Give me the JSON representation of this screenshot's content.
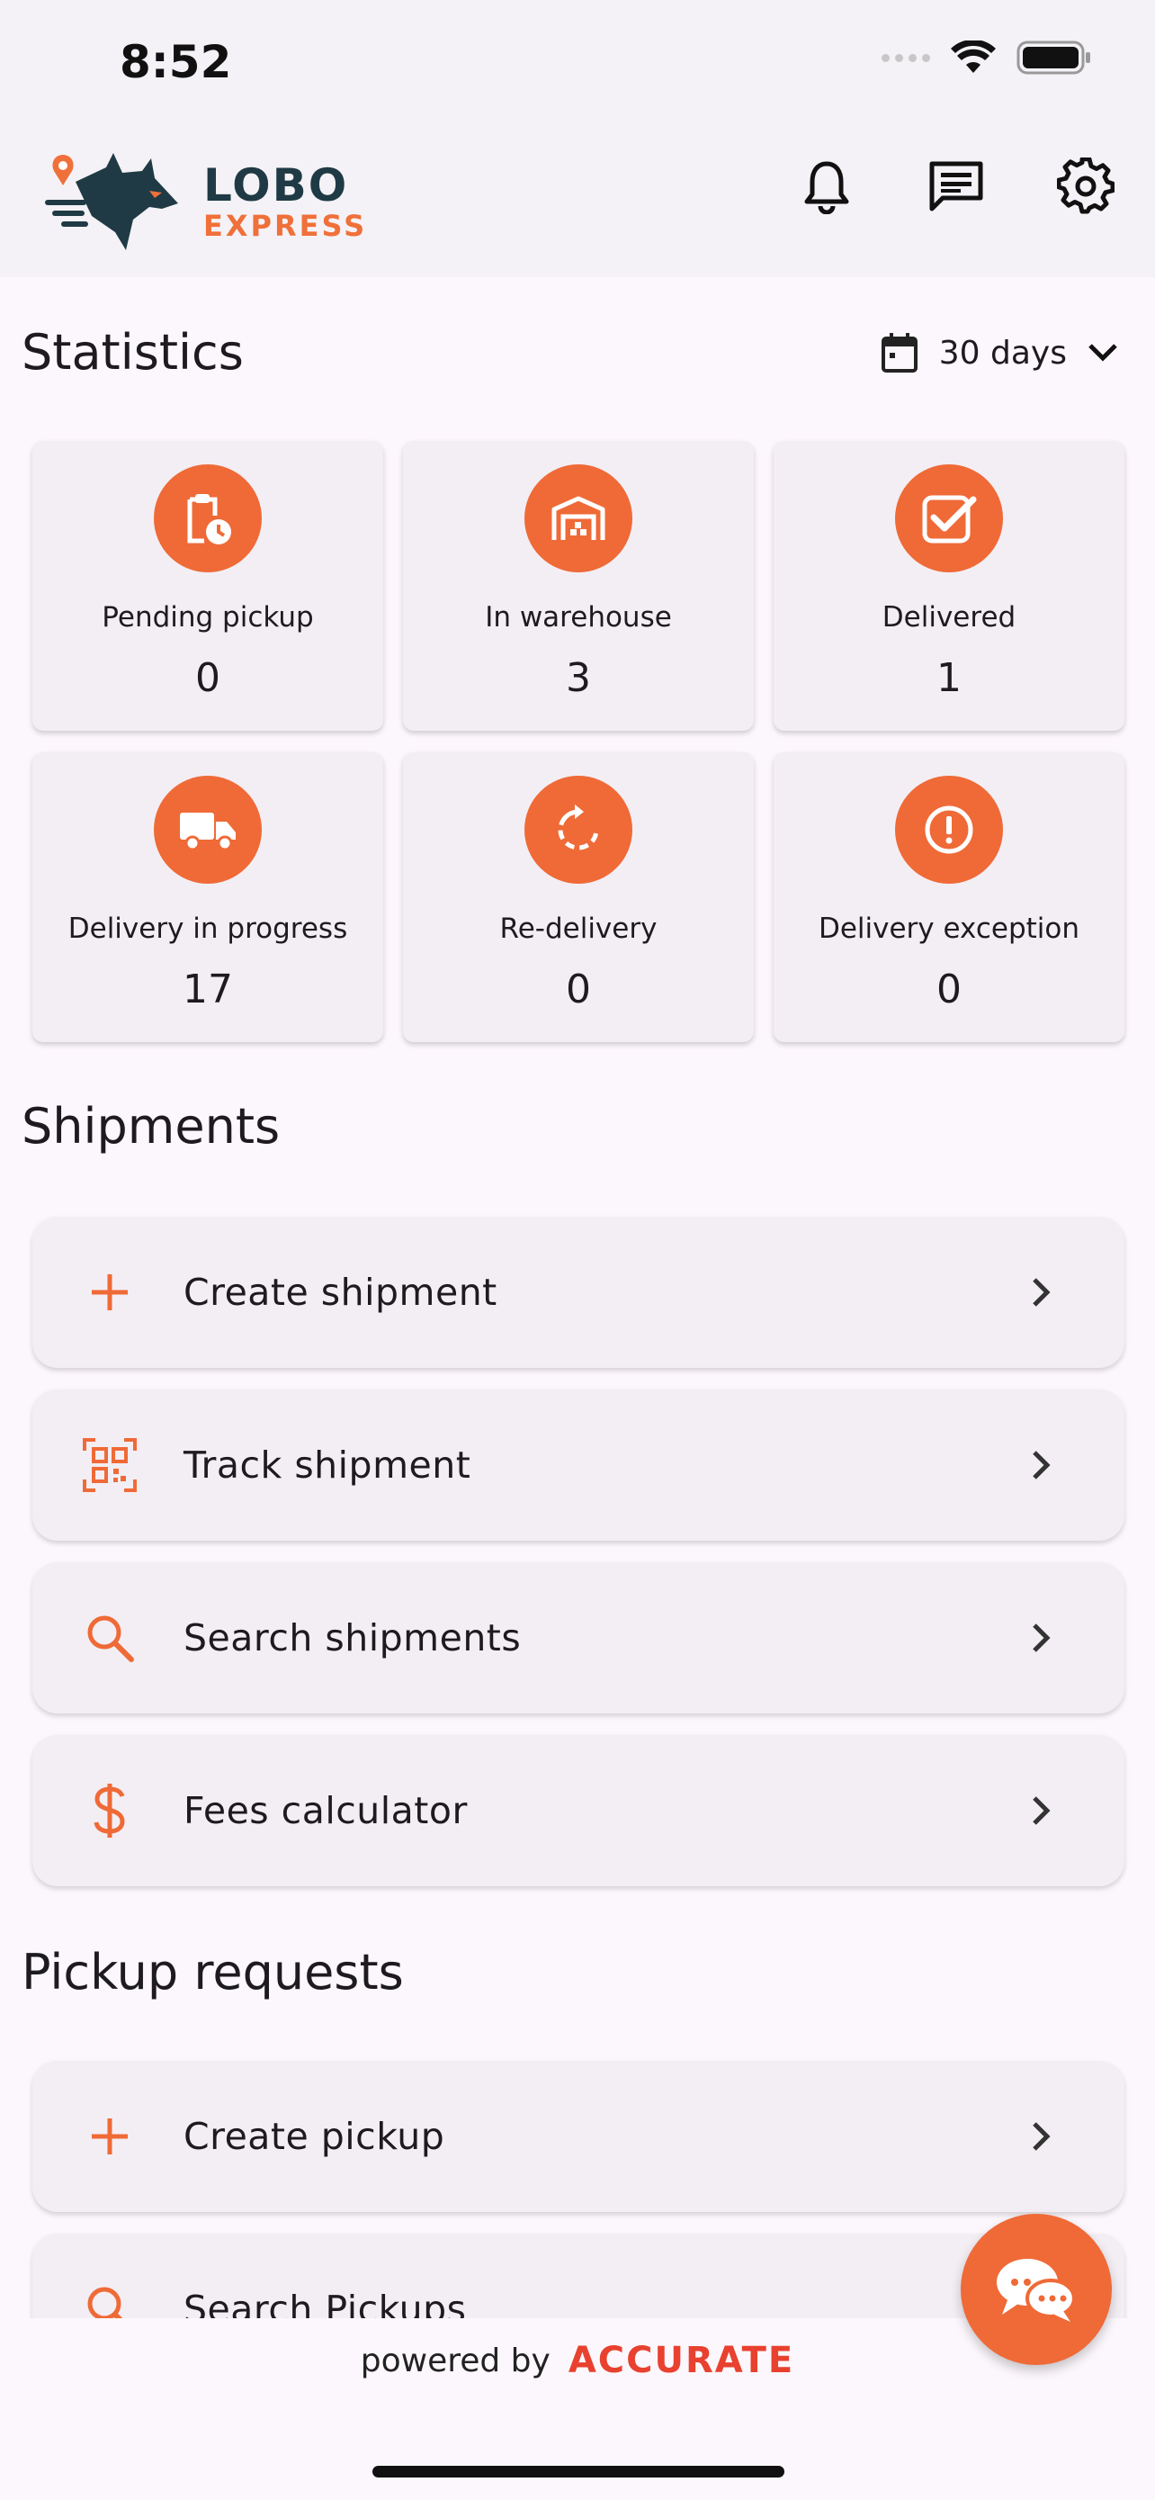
{
  "status_bar": {
    "time": "8:52"
  },
  "header": {
    "brand_line1": "LOBO",
    "brand_line2": "EXPRESS"
  },
  "statistics": {
    "title": "Statistics",
    "range": "30 days",
    "cards": [
      {
        "label": "Pending pickup",
        "value": "0",
        "icon": "clipboard-clock-icon"
      },
      {
        "label": "In warehouse",
        "value": "3",
        "icon": "warehouse-icon"
      },
      {
        "label": "Delivered",
        "value": "1",
        "icon": "check-box-icon"
      },
      {
        "label": "Delivery in progress",
        "value": "17",
        "icon": "truck-icon"
      },
      {
        "label": "Re-delivery",
        "value": "0",
        "icon": "redo-icon"
      },
      {
        "label": "Delivery exception",
        "value": "0",
        "icon": "alert-circle-icon"
      }
    ]
  },
  "shipments": {
    "title": "Shipments",
    "items": [
      {
        "label": "Create shipment",
        "icon": "plus-icon"
      },
      {
        "label": "Track shipment",
        "icon": "qr-code-icon"
      },
      {
        "label": "Search shipments",
        "icon": "search-icon"
      },
      {
        "label": "Fees calculator",
        "icon": "dollar-icon"
      }
    ]
  },
  "pickups": {
    "title": "Pickup requests",
    "items": [
      {
        "label": "Create pickup",
        "icon": "plus-icon"
      },
      {
        "label": "Search Pickups",
        "icon": "search-icon"
      }
    ]
  },
  "footer": {
    "powered_by": "powered by",
    "brand": "ACCURATE"
  },
  "colors": {
    "accent": "#ef6a37",
    "background": "#fcf7fc",
    "card": "#f3eef4",
    "brand_dark": "#1f3a44"
  }
}
